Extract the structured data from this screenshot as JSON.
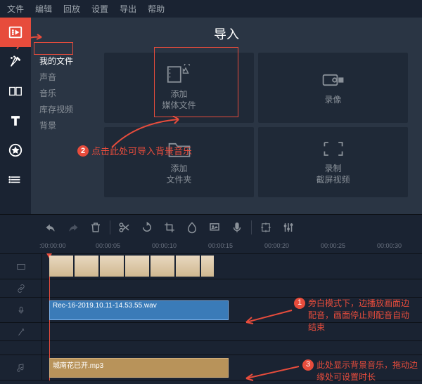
{
  "menubar": [
    "文件",
    "编辑",
    "回放",
    "设置",
    "导出",
    "帮助"
  ],
  "panel": {
    "title": "导入",
    "sidelist": [
      "我的文件",
      "声音",
      "音乐",
      "库存视频",
      "背景"
    ],
    "tiles": [
      {
        "label": "添加\n媒体文件"
      },
      {
        "label": "录像"
      },
      {
        "label": "添加\n文件夹"
      },
      {
        "label": "录制\n截屏视频"
      }
    ]
  },
  "annotations": {
    "a2": "点击此处可导入背景音乐",
    "a1": "旁白模式下，边播放画面边配音，画面停止则配音自动结束",
    "a3": "此处显示背景音乐，拖动边缘处可设置时长"
  },
  "ruler": [
    ":00:00:00",
    "00:00:05",
    "00:00:10",
    "00:00:15",
    "00:00:20",
    "00:00:25",
    "00:00:30"
  ],
  "clips": {
    "audio": "Rec-16-2019.10.11-14.53.55.wav",
    "music": "城南花已开.mp3"
  }
}
